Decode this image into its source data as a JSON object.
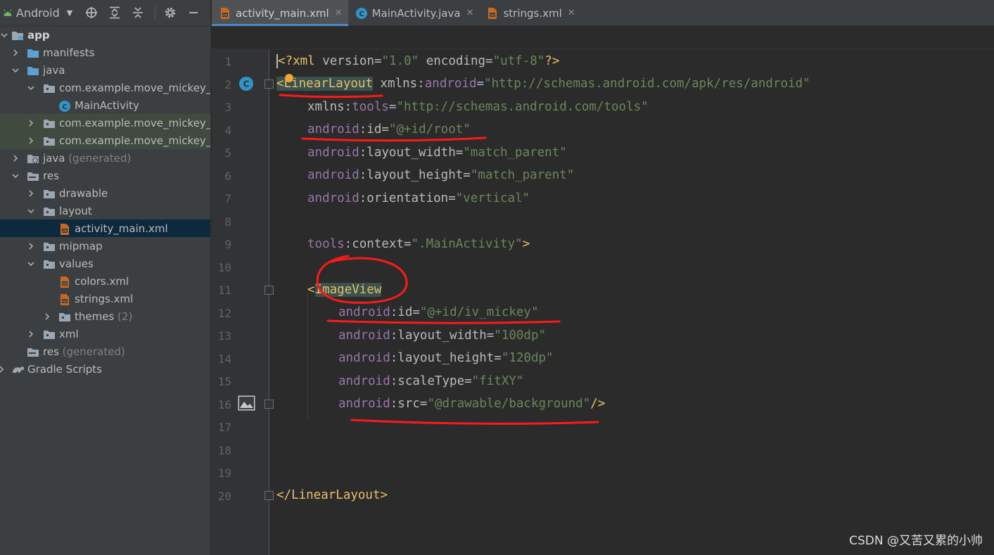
{
  "project_panel": {
    "title": "Android",
    "tree": [
      {
        "label": "app",
        "bold": true,
        "depth": 0,
        "arrow": "down",
        "icon": "module-folder-icon"
      },
      {
        "label": "manifests",
        "depth": 1,
        "arrow": "right",
        "icon": "folder-icon"
      },
      {
        "label": "java",
        "depth": 1,
        "arrow": "down",
        "icon": "folder-icon"
      },
      {
        "label": "com.example.move_mickey_b",
        "depth": 2,
        "arrow": "down",
        "icon": "package-icon"
      },
      {
        "label": "MainActivity",
        "depth": 3,
        "arrow": "none",
        "icon": "class-icon"
      },
      {
        "label": "com.example.move_mickey_b",
        "depth": 2,
        "arrow": "right",
        "icon": "package-icon"
      },
      {
        "label": "com.example.move_mickey_b",
        "depth": 2,
        "arrow": "right",
        "icon": "package-icon"
      },
      {
        "label": "java",
        "suffix": "(generated)",
        "depth": 1,
        "arrow": "right",
        "icon": "generated-folder-icon"
      },
      {
        "label": "res",
        "depth": 1,
        "arrow": "down",
        "icon": "res-folder-icon"
      },
      {
        "label": "drawable",
        "depth": 2,
        "arrow": "right",
        "icon": "package-icon"
      },
      {
        "label": "layout",
        "depth": 2,
        "arrow": "down",
        "icon": "package-icon"
      },
      {
        "label": "activity_main.xml",
        "depth": 3,
        "arrow": "none",
        "icon": "xml-file-icon"
      },
      {
        "label": "mipmap",
        "depth": 2,
        "arrow": "right",
        "icon": "package-icon"
      },
      {
        "label": "values",
        "depth": 2,
        "arrow": "down",
        "icon": "package-icon"
      },
      {
        "label": "colors.xml",
        "depth": 3,
        "arrow": "none",
        "icon": "xml-file-icon"
      },
      {
        "label": "strings.xml",
        "depth": 3,
        "arrow": "none",
        "icon": "xml-file-icon"
      },
      {
        "label": "themes",
        "suffix": "(2)",
        "depth": 3,
        "arrow": "right",
        "icon": "package-icon"
      },
      {
        "label": "xml",
        "depth": 2,
        "arrow": "right",
        "icon": "package-icon"
      },
      {
        "label": "res",
        "suffix": "(generated)",
        "depth": 1,
        "arrow": "none",
        "icon": "res-folder-icon"
      },
      {
        "label": "Gradle Scripts",
        "depth": 0,
        "arrow": "right",
        "icon": "gradle-icon"
      }
    ]
  },
  "tabs": [
    {
      "label": "activity_main.xml",
      "icon": "xml-file-icon",
      "active": true
    },
    {
      "label": "MainActivity.java",
      "icon": "class-icon",
      "active": false
    },
    {
      "label": "strings.xml",
      "icon": "xml-file-icon",
      "active": false
    }
  ],
  "code": {
    "line_numbers": [
      "1",
      "2",
      "3",
      "4",
      "5",
      "6",
      "7",
      "8",
      "9",
      "10",
      "11",
      "12",
      "13",
      "14",
      "15",
      "16",
      "17",
      "18",
      "19",
      "20"
    ],
    "l1": {
      "open": "<?",
      "tag": "xml",
      "a1": " version=",
      "v1": "\"1.0\"",
      "a2": " encoding=",
      "v2": "\"utf-8\"",
      "close": "?>"
    },
    "l2": {
      "open": "<",
      "tag": "LinearLayout",
      "a1": " xmlns:",
      "ns": "android",
      "eq": "=",
      "v1": "\"http://schemas.android.com/apk/res/android\""
    },
    "l3": {
      "a1": "xmlns:",
      "ns": "tools",
      "eq": "=",
      "v1": "\"http://schemas.android.com/tools\""
    },
    "l4": {
      "ns": "android",
      "a1": ":id=",
      "v1": "\"@+id/root\""
    },
    "l5": {
      "ns": "android",
      "a1": ":layout_width=",
      "v1": "\"match_parent\""
    },
    "l6": {
      "ns": "android",
      "a1": ":layout_height=",
      "v1": "\"match_parent\""
    },
    "l7": {
      "ns": "android",
      "a1": ":orientation=",
      "v1": "\"vertical\""
    },
    "l9": {
      "ns": "tools",
      "a1": ":context=",
      "v1": "\".MainActivity\"",
      "close": ">"
    },
    "l11": {
      "open": "<",
      "tag": "ImageView"
    },
    "l12": {
      "ns": "android",
      "a1": ":id=",
      "v1": "\"@+id/iv_mickey\""
    },
    "l13": {
      "ns": "android",
      "a1": ":layout_width=",
      "v1": "\"100dp\""
    },
    "l14": {
      "ns": "android",
      "a1": ":layout_height=",
      "v1": "\"120dp\""
    },
    "l15": {
      "ns": "android",
      "a1": ":scaleType=",
      "v1": "\"fitXY\""
    },
    "l16": {
      "ns": "android",
      "a1": ":src=",
      "v1": "\"@drawable/background\"",
      "close": "/>"
    },
    "l20": {
      "open": "</",
      "tag": "LinearLayout",
      "close": ">"
    }
  },
  "colors": {
    "tag": "#e8bf6a",
    "namespace": "#9876aa",
    "value": "#6a8759",
    "annotation": "#ff1a1a",
    "accent": "#4a88c7"
  },
  "watermark": "CSDN @又苦又累的小帅"
}
